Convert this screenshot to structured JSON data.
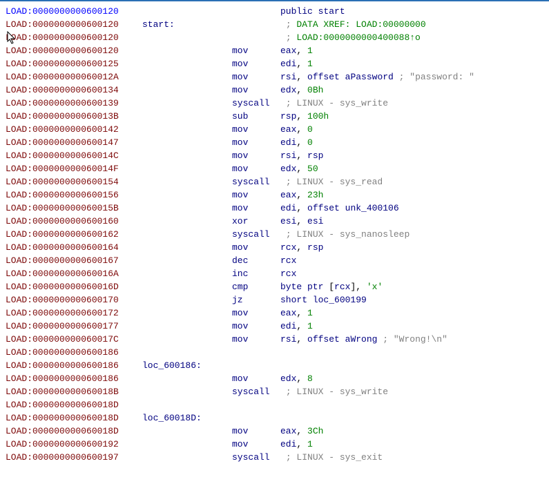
{
  "cursor_glyph": "↖",
  "lines": [
    {
      "addr": "LOAD:0000000000600120",
      "addr_cls": "seg-blue",
      "col1": "",
      "mnem": "",
      "mnem_cls": "kw",
      "rest": [
        {
          "t": "public ",
          "c": "kw"
        },
        {
          "t": "start",
          "c": "nm"
        }
      ]
    },
    {
      "addr": "LOAD:0000000000600120",
      "addr_cls": "seg",
      "col1": "start:",
      "col1_cls": "nm",
      "mnem": "",
      "rest": [
        {
          "t": "                           ",
          "c": ""
        },
        {
          "t": ";",
          "c": "cmt"
        },
        {
          "t": " DATA XREF: LOAD:00000000",
          "c": "cmt-green"
        }
      ]
    },
    {
      "addr": "LOAD:0000000000600120",
      "addr_cls": "seg",
      "col1": "",
      "mnem": "",
      "rest": [
        {
          "t": "                           ",
          "c": ""
        },
        {
          "t": ";",
          "c": "cmt"
        },
        {
          "t": " LOAD:0000000000400088↑o",
          "c": "up"
        }
      ]
    },
    {
      "addr": "LOAD:0000000000600120",
      "addr_cls": "seg",
      "col1": "",
      "mnem": "mov",
      "rest": [
        {
          "t": "eax",
          "c": "reg"
        },
        {
          "t": ", ",
          "c": ""
        },
        {
          "t": "1",
          "c": "num"
        }
      ]
    },
    {
      "addr": "LOAD:0000000000600125",
      "addr_cls": "seg",
      "col1": "",
      "mnem": "mov",
      "rest": [
        {
          "t": "edi",
          "c": "reg"
        },
        {
          "t": ", ",
          "c": ""
        },
        {
          "t": "1",
          "c": "num"
        }
      ]
    },
    {
      "addr": "LOAD:000000000060012A",
      "addr_cls": "seg",
      "col1": "",
      "mnem": "mov",
      "rest": [
        {
          "t": "rsi",
          "c": "reg"
        },
        {
          "t": ", ",
          "c": ""
        },
        {
          "t": "offset",
          "c": "kw"
        },
        {
          "t": " ",
          "c": ""
        },
        {
          "t": "aPassword",
          "c": "nm"
        },
        {
          "t": " ",
          "c": ""
        },
        {
          "t": "; \"password: \"",
          "c": "cmt"
        }
      ]
    },
    {
      "addr": "LOAD:0000000000600134",
      "addr_cls": "seg",
      "col1": "",
      "mnem": "mov",
      "rest": [
        {
          "t": "edx",
          "c": "reg"
        },
        {
          "t": ", ",
          "c": ""
        },
        {
          "t": "0Bh",
          "c": "num"
        }
      ]
    },
    {
      "addr": "LOAD:0000000000600139",
      "addr_cls": "seg",
      "col1": "",
      "mnem": "syscall",
      "rest": [
        {
          "t": "              ",
          "c": ""
        },
        {
          "t": "; LINUX - sys_write",
          "c": "cmt"
        }
      ]
    },
    {
      "addr": "LOAD:000000000060013B",
      "addr_cls": "seg",
      "col1": "",
      "mnem": "sub",
      "rest": [
        {
          "t": "rsp",
          "c": "reg"
        },
        {
          "t": ", ",
          "c": ""
        },
        {
          "t": "100h",
          "c": "num"
        }
      ]
    },
    {
      "addr": "LOAD:0000000000600142",
      "addr_cls": "seg",
      "col1": "",
      "mnem": "mov",
      "rest": [
        {
          "t": "eax",
          "c": "reg"
        },
        {
          "t": ", ",
          "c": ""
        },
        {
          "t": "0",
          "c": "num"
        }
      ]
    },
    {
      "addr": "LOAD:0000000000600147",
      "addr_cls": "seg",
      "col1": "",
      "mnem": "mov",
      "rest": [
        {
          "t": "edi",
          "c": "reg"
        },
        {
          "t": ", ",
          "c": ""
        },
        {
          "t": "0",
          "c": "num"
        }
      ]
    },
    {
      "addr": "LOAD:000000000060014C",
      "addr_cls": "seg",
      "col1": "",
      "mnem": "mov",
      "rest": [
        {
          "t": "rsi",
          "c": "reg"
        },
        {
          "t": ", ",
          "c": ""
        },
        {
          "t": "rsp",
          "c": "reg"
        }
      ]
    },
    {
      "addr": "LOAD:000000000060014F",
      "addr_cls": "seg",
      "col1": "",
      "mnem": "mov",
      "rest": [
        {
          "t": "edx",
          "c": "reg"
        },
        {
          "t": ", ",
          "c": ""
        },
        {
          "t": "50",
          "c": "num"
        }
      ]
    },
    {
      "addr": "LOAD:0000000000600154",
      "addr_cls": "seg",
      "col1": "",
      "mnem": "syscall",
      "rest": [
        {
          "t": "              ",
          "c": ""
        },
        {
          "t": "; LINUX - sys_read",
          "c": "cmt"
        }
      ]
    },
    {
      "addr": "LOAD:0000000000600156",
      "addr_cls": "seg",
      "col1": "",
      "mnem": "mov",
      "rest": [
        {
          "t": "eax",
          "c": "reg"
        },
        {
          "t": ", ",
          "c": ""
        },
        {
          "t": "23h",
          "c": "num"
        }
      ]
    },
    {
      "addr": "LOAD:000000000060015B",
      "addr_cls": "seg",
      "col1": "",
      "mnem": "mov",
      "rest": [
        {
          "t": "edi",
          "c": "reg"
        },
        {
          "t": ", ",
          "c": ""
        },
        {
          "t": "offset",
          "c": "kw"
        },
        {
          "t": " ",
          "c": ""
        },
        {
          "t": "unk_400106",
          "c": "nm"
        }
      ]
    },
    {
      "addr": "LOAD:0000000000600160",
      "addr_cls": "seg",
      "col1": "",
      "mnem": "xor",
      "rest": [
        {
          "t": "esi",
          "c": "reg"
        },
        {
          "t": ", ",
          "c": ""
        },
        {
          "t": "esi",
          "c": "reg"
        }
      ]
    },
    {
      "addr": "LOAD:0000000000600162",
      "addr_cls": "seg",
      "col1": "",
      "mnem": "syscall",
      "rest": [
        {
          "t": "              ",
          "c": ""
        },
        {
          "t": "; LINUX - sys_nanosleep",
          "c": "cmt"
        }
      ]
    },
    {
      "addr": "LOAD:0000000000600164",
      "addr_cls": "seg",
      "col1": "",
      "mnem": "mov",
      "rest": [
        {
          "t": "rcx",
          "c": "reg"
        },
        {
          "t": ", ",
          "c": ""
        },
        {
          "t": "rsp",
          "c": "reg"
        }
      ]
    },
    {
      "addr": "LOAD:0000000000600167",
      "addr_cls": "seg",
      "col1": "",
      "mnem": "dec",
      "rest": [
        {
          "t": "rcx",
          "c": "reg"
        }
      ]
    },
    {
      "addr": "LOAD:000000000060016A",
      "addr_cls": "seg",
      "col1": "",
      "mnem": "inc",
      "rest": [
        {
          "t": "rcx",
          "c": "reg"
        }
      ]
    },
    {
      "addr": "LOAD:000000000060016D",
      "addr_cls": "seg",
      "col1": "",
      "mnem": "cmp",
      "rest": [
        {
          "t": "byte ptr",
          "c": "kw"
        },
        {
          "t": " [",
          "c": ""
        },
        {
          "t": "rcx",
          "c": "reg"
        },
        {
          "t": "], ",
          "c": ""
        },
        {
          "t": "'x'",
          "c": "num"
        }
      ]
    },
    {
      "addr": "LOAD:0000000000600170",
      "addr_cls": "seg",
      "col1": "",
      "mnem": "jz",
      "rest": [
        {
          "t": "short",
          "c": "kw"
        },
        {
          "t": " ",
          "c": ""
        },
        {
          "t": "loc_600199",
          "c": "nm"
        }
      ]
    },
    {
      "addr": "LOAD:0000000000600172",
      "addr_cls": "seg",
      "col1": "",
      "mnem": "mov",
      "rest": [
        {
          "t": "eax",
          "c": "reg"
        },
        {
          "t": ", ",
          "c": ""
        },
        {
          "t": "1",
          "c": "num"
        }
      ]
    },
    {
      "addr": "LOAD:0000000000600177",
      "addr_cls": "seg",
      "col1": "",
      "mnem": "mov",
      "rest": [
        {
          "t": "edi",
          "c": "reg"
        },
        {
          "t": ", ",
          "c": ""
        },
        {
          "t": "1",
          "c": "num"
        }
      ]
    },
    {
      "addr": "LOAD:000000000060017C",
      "addr_cls": "seg",
      "col1": "",
      "mnem": "mov",
      "rest": [
        {
          "t": "rsi",
          "c": "reg"
        },
        {
          "t": ", ",
          "c": ""
        },
        {
          "t": "offset",
          "c": "kw"
        },
        {
          "t": " ",
          "c": ""
        },
        {
          "t": "aWrong",
          "c": "nm"
        },
        {
          "t": " ",
          "c": ""
        },
        {
          "t": "; \"Wrong!\\n\"",
          "c": "cmt"
        }
      ]
    },
    {
      "addr": "LOAD:0000000000600186",
      "addr_cls": "seg",
      "col1": "",
      "mnem": "",
      "rest": []
    },
    {
      "addr": "LOAD:0000000000600186",
      "addr_cls": "seg",
      "col1": "loc_600186:",
      "col1_cls": "nm",
      "mnem": "",
      "rest": []
    },
    {
      "addr": "LOAD:0000000000600186",
      "addr_cls": "seg",
      "col1": "",
      "mnem": "mov",
      "rest": [
        {
          "t": "edx",
          "c": "reg"
        },
        {
          "t": ", ",
          "c": ""
        },
        {
          "t": "8",
          "c": "num"
        }
      ]
    },
    {
      "addr": "LOAD:000000000060018B",
      "addr_cls": "seg",
      "col1": "",
      "mnem": "syscall",
      "rest": [
        {
          "t": "              ",
          "c": ""
        },
        {
          "t": "; LINUX - sys_write",
          "c": "cmt"
        }
      ]
    },
    {
      "addr": "LOAD:000000000060018D",
      "addr_cls": "seg",
      "col1": "",
      "mnem": "",
      "rest": []
    },
    {
      "addr": "LOAD:000000000060018D",
      "addr_cls": "seg",
      "col1": "loc_60018D:",
      "col1_cls": "nm",
      "mnem": "",
      "rest": []
    },
    {
      "addr": "LOAD:000000000060018D",
      "addr_cls": "seg",
      "col1": "",
      "mnem": "mov",
      "rest": [
        {
          "t": "eax",
          "c": "reg"
        },
        {
          "t": ", ",
          "c": ""
        },
        {
          "t": "3Ch",
          "c": "num"
        }
      ]
    },
    {
      "addr": "LOAD:0000000000600192",
      "addr_cls": "seg",
      "col1": "",
      "mnem": "mov",
      "rest": [
        {
          "t": "edi",
          "c": "reg"
        },
        {
          "t": ", ",
          "c": ""
        },
        {
          "t": "1",
          "c": "num"
        }
      ]
    },
    {
      "addr": "LOAD:0000000000600197",
      "addr_cls": "seg",
      "col1": "",
      "mnem": "syscall",
      "rest": [
        {
          "t": "              ",
          "c": ""
        },
        {
          "t": "; LINUX - sys_exit",
          "c": "cmt"
        }
      ]
    }
  ]
}
